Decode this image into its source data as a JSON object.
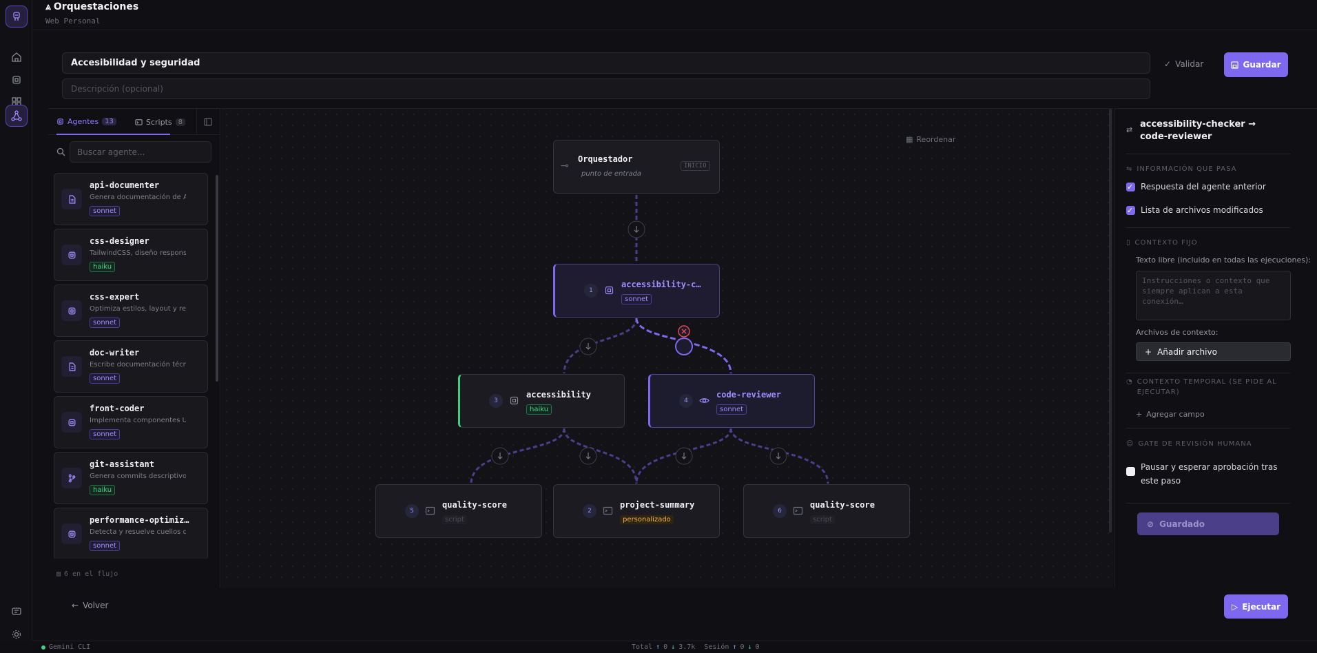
{
  "header": {
    "title": "Orquestaciones",
    "subtitle": "Web Personal"
  },
  "form": {
    "name_value": "Accesibilidad y seguridad",
    "description_placeholder": "Descripción (opcional)",
    "validate_label": "Validar",
    "save_label": "Guardar"
  },
  "sidebar": {
    "tabs": [
      {
        "label": "Agentes",
        "count": "13"
      },
      {
        "label": "Scripts",
        "count": "8"
      }
    ],
    "search_placeholder": "Buscar agente...",
    "agents": [
      {
        "name": "api-documenter",
        "desc": "Genera documentación de A...",
        "model": "sonnet",
        "icon": "document-icon"
      },
      {
        "name": "css-designer",
        "desc": "TailwindCSS, diseño responsiv...",
        "model": "haiku",
        "icon": "chip-icon"
      },
      {
        "name": "css-expert",
        "desc": "Optimiza estilos, layout y resp...",
        "model": "sonnet",
        "icon": "chip-icon"
      },
      {
        "name": "doc-writer",
        "desc": "Escribe documentación técni...",
        "model": "sonnet",
        "icon": "document-icon"
      },
      {
        "name": "front-coder",
        "desc": "Implementa componentes UI...",
        "model": "sonnet",
        "icon": "chip-icon"
      },
      {
        "name": "git-assistant",
        "desc": "Genera commits descriptivos,...",
        "model": "haiku",
        "icon": "git-branch-icon"
      },
      {
        "name": "performance-optimiz…",
        "desc": "Detecta y resuelve cuellos de ...",
        "model": "sonnet",
        "icon": "chip-icon"
      }
    ],
    "flow_count": "6 en el flujo"
  },
  "canvas": {
    "reorder_label": "Reordenar",
    "start": {
      "title": "Orquestador",
      "subtitle": "punto de entrada",
      "tag": "INICIO"
    },
    "nodes": [
      {
        "num": "1",
        "title": "accessibility-c…",
        "badge": "sonnet"
      },
      {
        "num": "3",
        "title": "accessibility",
        "badge": "haiku"
      },
      {
        "num": "4",
        "title": "code-reviewer",
        "badge": "sonnet"
      },
      {
        "num": "5",
        "title": "quality-score",
        "badge": "script"
      },
      {
        "num": "2",
        "title": "project-summary",
        "badge": "personalizado"
      },
      {
        "num": "6",
        "title": "quality-score",
        "badge": "script"
      }
    ]
  },
  "connection": {
    "title": "accessibility-checker → code-reviewer",
    "info_section": "INFORMACIÓN QUE PASA",
    "check_prev": "Respuesta del agente anterior",
    "check_files": "Lista de archivos modificados",
    "fixed_section": "CONTEXTO FIJO",
    "free_text_label": "Texto libre (incluido en todas las ejecuciones):",
    "free_text_placeholder": "Instrucciones o contexto que siempre aplican a esta conexión…",
    "context_files_label": "Archivos de contexto:",
    "add_file": "Añadir archivo",
    "temporal_section": "CONTEXTO TEMPORAL (SE PIDE AL EJECUTAR)",
    "add_field": "Agregar campo",
    "gate_section": "GATE DE REVISIÓN HUMANA",
    "gate_check": "Pausar y esperar aprobación tras este paso",
    "saved_label": "Guardado"
  },
  "footer": {
    "back_label": "Volver",
    "run_label": "Ejecutar"
  },
  "status": {
    "provider": "Gemini CLI",
    "total_label": "Total",
    "total_up": "0",
    "total_down": "3.7k",
    "session_label": "Sesión",
    "session_up": "0",
    "session_down": "0"
  },
  "colors": {
    "accent": "#7e68f0",
    "haiku": "#3fcf84",
    "custom": "#f5b342",
    "remove": "#e5484d"
  }
}
